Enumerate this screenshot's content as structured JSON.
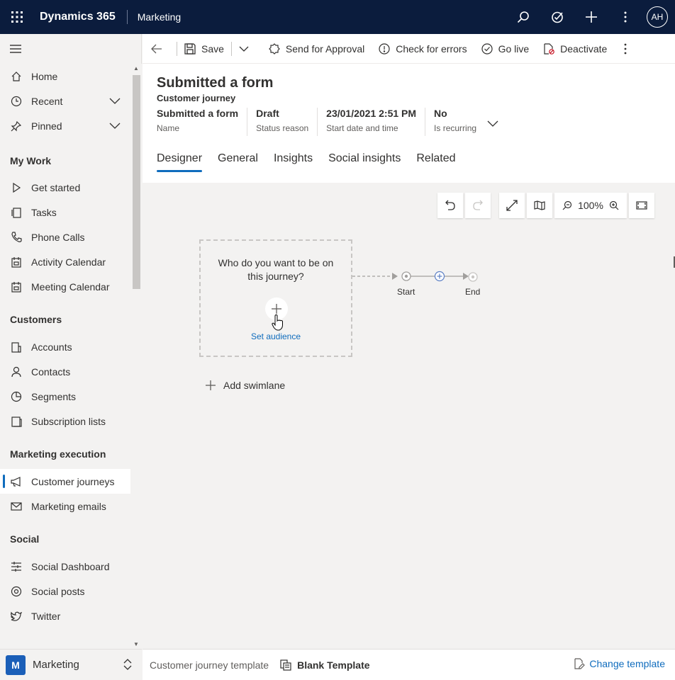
{
  "topbar": {
    "app_title": "Dynamics 365",
    "app_area": "Marketing",
    "avatar": "AH"
  },
  "commands": {
    "back": "back-icon",
    "save": "Save",
    "send_approval": "Send for Approval",
    "check_errors": "Check for errors",
    "go_live": "Go live",
    "deactivate": "Deactivate"
  },
  "sidebar": {
    "top_items": [
      {
        "label": "Home",
        "icon": "home-icon"
      },
      {
        "label": "Recent",
        "icon": "clock-icon"
      },
      {
        "label": "Pinned",
        "icon": "pin-icon"
      }
    ],
    "groups": [
      {
        "title": "My Work",
        "items": [
          "Get started",
          "Tasks",
          "Phone Calls",
          "Activity Calendar",
          "Meeting Calendar"
        ]
      },
      {
        "title": "Customers",
        "items": [
          "Accounts",
          "Contacts",
          "Segments",
          "Subscription lists"
        ]
      },
      {
        "title": "Marketing execution",
        "items": [
          "Customer journeys",
          "Marketing emails"
        ]
      },
      {
        "title": "Social",
        "items": [
          "Social Dashboard",
          "Social posts",
          "Twitter"
        ]
      }
    ],
    "area": {
      "badge": "M",
      "label": "Marketing"
    }
  },
  "record": {
    "title": "Submitted a form",
    "entity": "Customer journey",
    "fields": [
      {
        "value": "Submitted a form",
        "label": "Name"
      },
      {
        "value": "Draft",
        "label": "Status reason"
      },
      {
        "value": "23/01/2021 2:51 PM",
        "label": "Start date and time"
      },
      {
        "value": "No",
        "label": "Is recurring"
      }
    ],
    "tabs": [
      "Designer",
      "General",
      "Insights",
      "Social insights",
      "Related"
    ],
    "active_tab": "Designer"
  },
  "canvas": {
    "zoom": "100%",
    "audience_question": "Who do you want to be on this journey?",
    "set_audience": "Set audience",
    "start_label": "Start",
    "end_label": "End",
    "add_swimlane": "Add swimlane"
  },
  "footer": {
    "template_label": "Customer journey template",
    "template_name": "Blank Template",
    "change_template": "Change template"
  },
  "colors": {
    "topbar": "#0b1c3d",
    "accent": "#0f6cbd",
    "area_badge": "#1b5fb8"
  }
}
